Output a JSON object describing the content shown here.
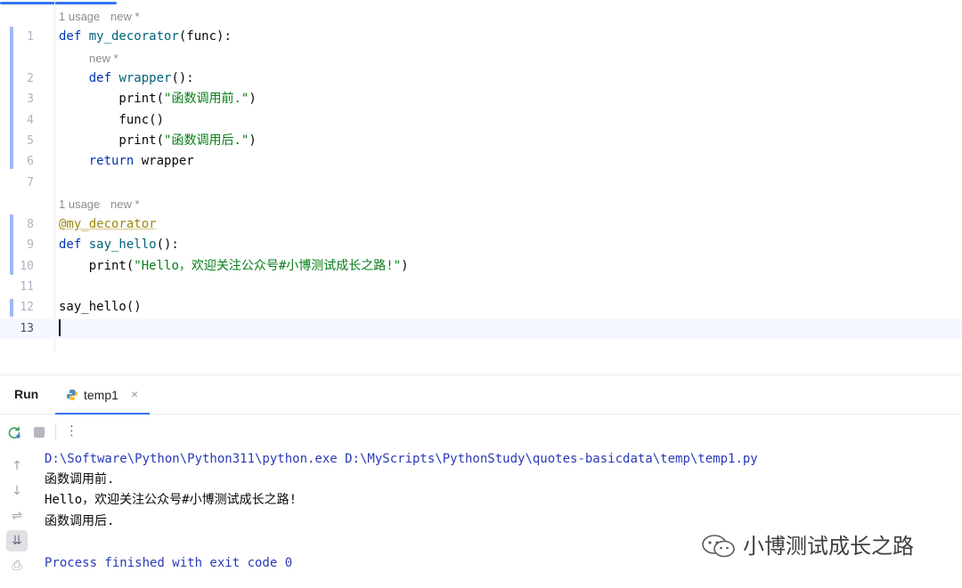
{
  "editor": {
    "hints": {
      "usage_1": "1 usage",
      "new_1": "new *",
      "new_2": "new *",
      "usage_2": "1 usage",
      "new_3": "new *"
    },
    "lines": [
      {
        "num": "1",
        "parts": [
          {
            "t": "def ",
            "c": "kw"
          },
          {
            "t": "my_decorator",
            "c": "fn"
          },
          {
            "t": "(func):",
            "c": ""
          }
        ]
      },
      {
        "num": "2",
        "parts": [
          {
            "t": "    ",
            "c": ""
          },
          {
            "t": "def ",
            "c": "kw"
          },
          {
            "t": "wrapper",
            "c": "fn"
          },
          {
            "t": "():",
            "c": ""
          }
        ]
      },
      {
        "num": "3",
        "parts": [
          {
            "t": "        print(",
            "c": ""
          },
          {
            "t": "\"函数调用前.\"",
            "c": "str"
          },
          {
            "t": ")",
            "c": ""
          }
        ]
      },
      {
        "num": "4",
        "parts": [
          {
            "t": "        func()",
            "c": ""
          }
        ]
      },
      {
        "num": "5",
        "parts": [
          {
            "t": "        print(",
            "c": ""
          },
          {
            "t": "\"函数调用后.\"",
            "c": "str"
          },
          {
            "t": ")",
            "c": ""
          }
        ]
      },
      {
        "num": "6",
        "parts": [
          {
            "t": "    ",
            "c": ""
          },
          {
            "t": "return ",
            "c": "kw"
          },
          {
            "t": "wrapper",
            "c": ""
          }
        ]
      },
      {
        "num": "7",
        "parts": []
      },
      {
        "num": "8",
        "parts": [
          {
            "t": "@my_decorator",
            "c": "deco"
          }
        ]
      },
      {
        "num": "9",
        "parts": [
          {
            "t": "def ",
            "c": "kw"
          },
          {
            "t": "say_hello",
            "c": "fn"
          },
          {
            "t": "():",
            "c": ""
          }
        ]
      },
      {
        "num": "10",
        "parts": [
          {
            "t": "    print(",
            "c": ""
          },
          {
            "t": "\"Hello，欢迎关注公众号#小博测试成长之路!\"",
            "c": "str"
          },
          {
            "t": ")",
            "c": ""
          }
        ]
      },
      {
        "num": "11",
        "parts": []
      },
      {
        "num": "12",
        "parts": [
          {
            "t": "say_hello()",
            "c": ""
          }
        ]
      },
      {
        "num": "13",
        "parts": []
      }
    ]
  },
  "run": {
    "title": "Run",
    "tab_label": "temp1",
    "tab_close": "×",
    "more": "⋮",
    "output": {
      "command": "D:\\Software\\Python\\Python311\\python.exe D:\\MyScripts\\PythonStudy\\quotes-basicdata\\temp\\temp1.py",
      "line1": "函数调用前.",
      "line2": "Hello，欢迎关注公众号#小博测试成长之路!",
      "line3": "函数调用后.",
      "exit": "Process finished with exit code 0"
    },
    "side": {
      "up": "↑",
      "down": "↓",
      "wrap": "⇌",
      "scroll_end": "⇊",
      "print": "⎙"
    }
  },
  "watermark": {
    "text": "小博测试成长之路"
  },
  "colors": {
    "keyword": "#0033b3",
    "function": "#00627a",
    "string": "#067d17",
    "decorator": "#9e880d",
    "console_system": "#2b39b8",
    "accent": "#3574f0"
  }
}
